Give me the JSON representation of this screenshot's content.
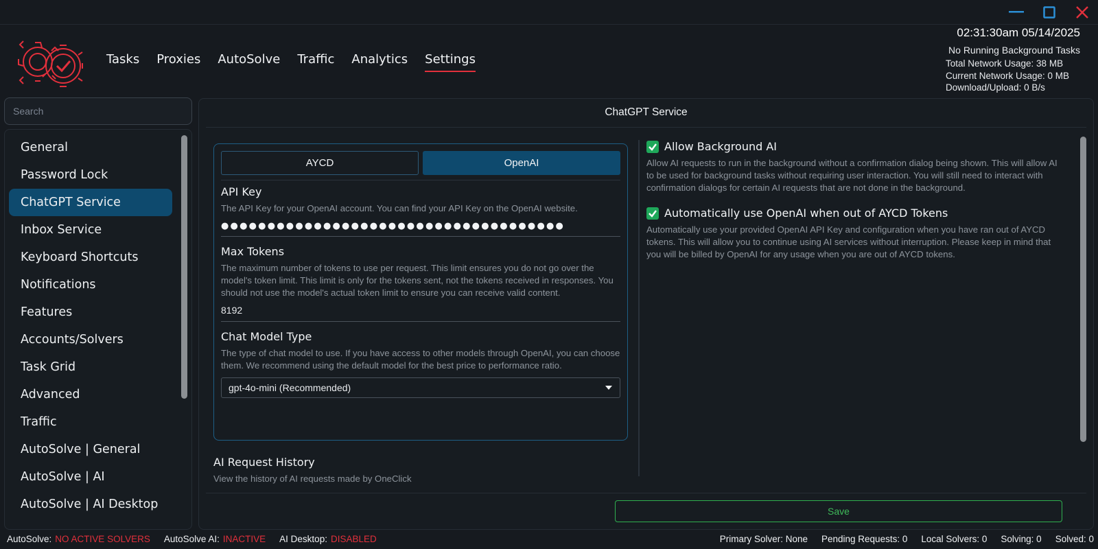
{
  "header": {
    "nav": [
      "Tasks",
      "Proxies",
      "AutoSolve",
      "Traffic",
      "Analytics",
      "Settings"
    ],
    "active_nav": "Settings",
    "clock": "02:31:30am 05/14/2025",
    "background_tasks": "No Running Background Tasks",
    "total_network": "Total Network Usage:  38 MB",
    "current_network": "Current Network Usage: 0 MB",
    "download_upload": "Download/Upload: 0 B/s"
  },
  "sidebar": {
    "search_placeholder": "Search",
    "items": [
      "General",
      "Password Lock",
      "ChatGPT Service",
      "Inbox Service",
      "Keyboard Shortcuts",
      "Notifications",
      "Features",
      "Accounts/Solvers",
      "Task Grid",
      "Advanced",
      "Traffic",
      "AutoSolve | General",
      "AutoSolve | AI",
      "AutoSolve | AI Desktop"
    ],
    "active_item": "ChatGPT Service"
  },
  "main": {
    "title": "ChatGPT Service",
    "tabs": [
      "AYCD",
      "OpenAI"
    ],
    "active_tab": "OpenAI",
    "api_key": {
      "label": "API Key",
      "description": "The API Key for your OpenAI account. You can find your API Key on the OpenAI website.",
      "value_masked": "●●●●●●●●●●●●●●●●●●●●●●●●●●●●●●●●●●●●●"
    },
    "max_tokens": {
      "label": "Max Tokens",
      "description": "The maximum number of tokens to use per request. This limit ensures you do not go over the model's token limit. This limit is only for the tokens sent, not the tokens received in responses. You should not use the model's actual token limit to ensure you can receive valid content.",
      "value": "8192"
    },
    "chat_model": {
      "label": "Chat Model Type",
      "description": "The type of chat model to use. If you have access to other models through OpenAI, you can choose them. We recommend using the default model for the best price to performance ratio.",
      "selected": "gpt-4o-mini (Recommended)"
    },
    "history": {
      "label": "AI Request History",
      "description": "View the history of AI requests made by OneClick"
    },
    "options": [
      {
        "label": "Allow Background AI",
        "checked": true,
        "description": "Allow AI requests to run in the background without a confirmation dialog being shown. This will allow AI to be used for background tasks without requiring user interaction. You will still need to interact with confirmation dialogs for certain AI requests that are not done in the background."
      },
      {
        "label": "Automatically use OpenAI when out of AYCD Tokens",
        "checked": true,
        "description": "Automatically use your provided OpenAI API Key and configuration when you have ran out of AYCD tokens. This will allow you to continue using AI services without interruption. Please keep in mind that you will be billed by OpenAI for any usage when you are out of AYCD tokens."
      }
    ],
    "save_label": "Save"
  },
  "footer": {
    "autosolve_label": "AutoSolve:",
    "autosolve_value": "NO ACTIVE SOLVERS",
    "autosolve_ai_label": "AutoSolve AI:",
    "autosolve_ai_value": "INACTIVE",
    "ai_desktop_label": "AI Desktop:",
    "ai_desktop_value": "DISABLED",
    "primary_solver": "Primary Solver: None",
    "pending_requests": "Pending Requests: 0",
    "local_solvers": "Local Solvers: 0",
    "solving": "Solving: 0",
    "solved": "Solved: 0"
  },
  "colors": {
    "accent": "#0e4a6e",
    "danger": "#e2303c",
    "success": "#2fb04f",
    "background": "#161a1f"
  }
}
